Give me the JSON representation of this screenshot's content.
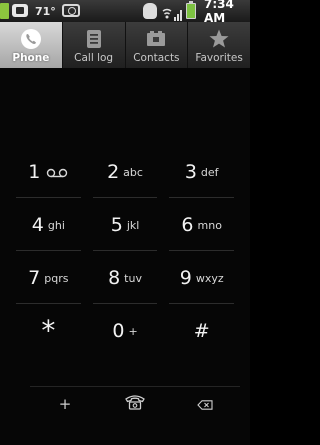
{
  "status_bar": {
    "temperature": "71°",
    "time": "7:34 AM"
  },
  "tabs": [
    {
      "label": "Phone",
      "icon": "phone-icon",
      "active": true
    },
    {
      "label": "Call log",
      "icon": "call-log-icon",
      "active": false
    },
    {
      "label": "Contacts",
      "icon": "contacts-icon",
      "active": false
    },
    {
      "label": "Favorites",
      "icon": "star-icon",
      "active": false
    }
  ],
  "dialpad": {
    "keys": [
      {
        "digit": "1",
        "letters": "",
        "icon": "voicemail-icon"
      },
      {
        "digit": "2",
        "letters": "abc"
      },
      {
        "digit": "3",
        "letters": "def"
      },
      {
        "digit": "4",
        "letters": "ghi"
      },
      {
        "digit": "5",
        "letters": "jkl"
      },
      {
        "digit": "6",
        "letters": "mno"
      },
      {
        "digit": "7",
        "letters": "pqrs"
      },
      {
        "digit": "8",
        "letters": "tuv"
      },
      {
        "digit": "9",
        "letters": "wxyz"
      },
      {
        "digit": "*",
        "letters": ""
      },
      {
        "digit": "0",
        "letters": "+"
      },
      {
        "digit": "#",
        "letters": ""
      }
    ]
  },
  "actions": {
    "add_label": "+",
    "call_icon": "phone-icon",
    "delete_icon": "backspace-icon"
  },
  "colors": {
    "background": "#060606",
    "active_tab": "#bcbcbc",
    "signal_green": "#8cc63e",
    "battery_green": "#7dc242"
  }
}
